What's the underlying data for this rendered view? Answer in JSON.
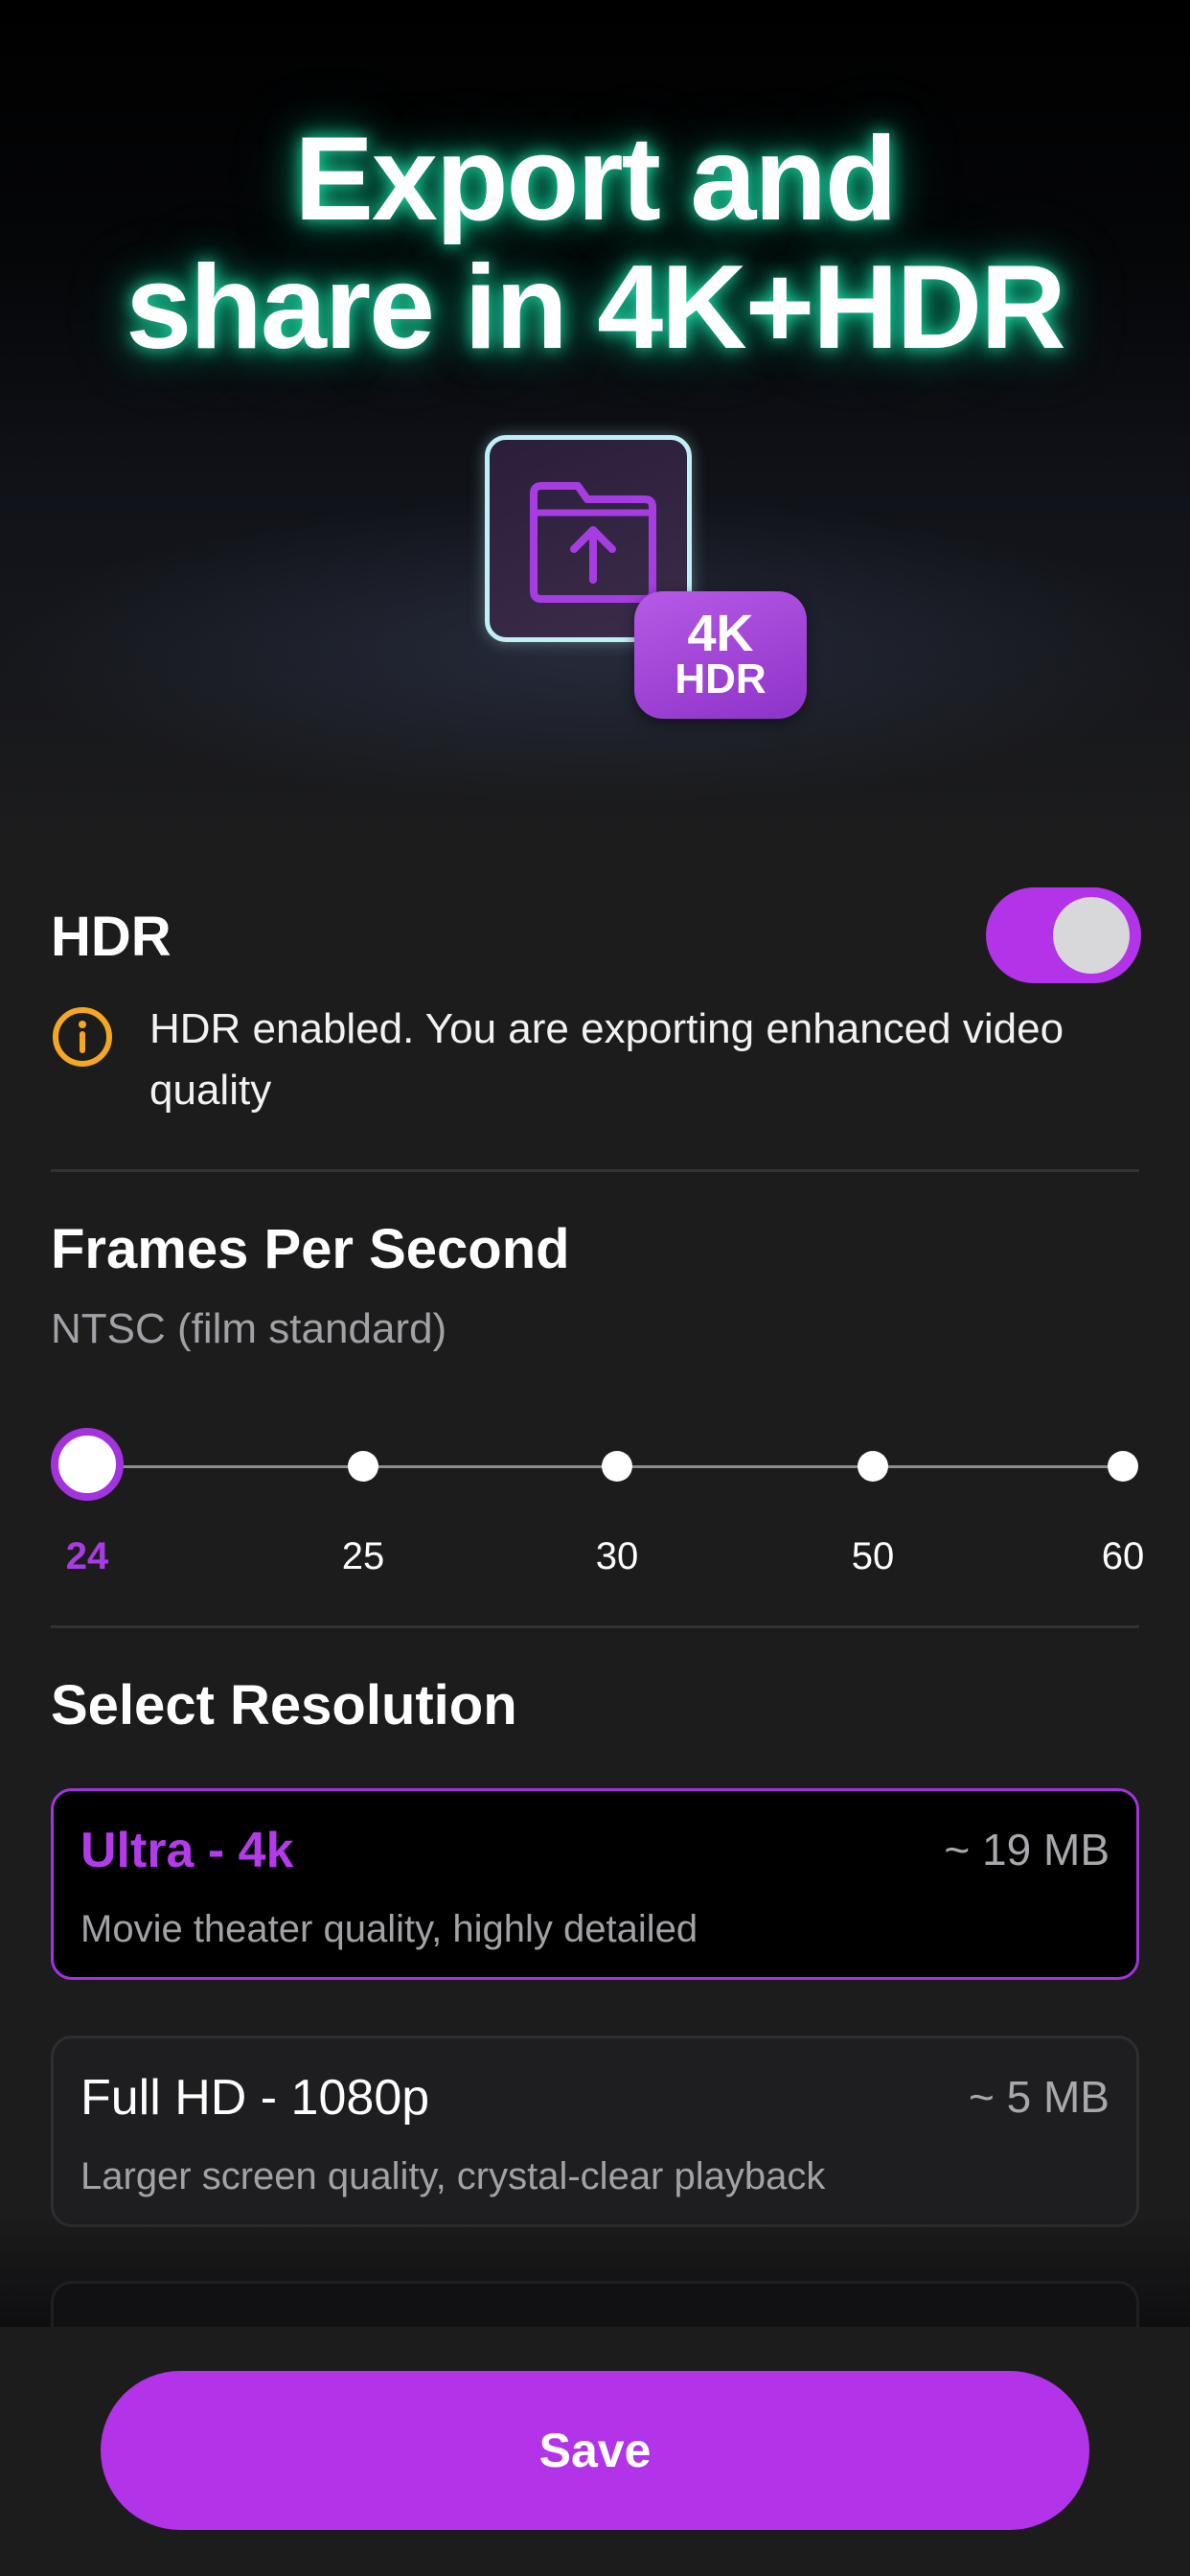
{
  "hero": {
    "title_line1": "Export and",
    "title_line2": "share in 4K+HDR",
    "badge_line1": "4K",
    "badge_line2": "HDR",
    "icon": "folder-upload-icon"
  },
  "hdr": {
    "label": "HDR",
    "enabled": true,
    "info_text": "HDR enabled. You are exporting enhanced video quality",
    "info_icon": "info-icon"
  },
  "fps": {
    "title": "Frames Per Second",
    "subtitle": "NTSC (film standard)",
    "options": [
      "24",
      "25",
      "30",
      "50",
      "60"
    ],
    "selected": "24"
  },
  "resolution": {
    "title": "Select Resolution",
    "options": [
      {
        "name": "Ultra - 4k",
        "size": "~ 19 MB",
        "description": "Movie theater quality, highly detailed",
        "selected": true
      },
      {
        "name": "Full HD - 1080p",
        "size": "~ 5 MB",
        "description": "Larger screen quality, crystal-clear playback",
        "selected": false
      }
    ]
  },
  "footer": {
    "save_label": "Save"
  },
  "colors": {
    "accent": "#b233e8",
    "background": "#1c1c1d",
    "warning": "#f5a623",
    "glow": "#28ffbe"
  }
}
